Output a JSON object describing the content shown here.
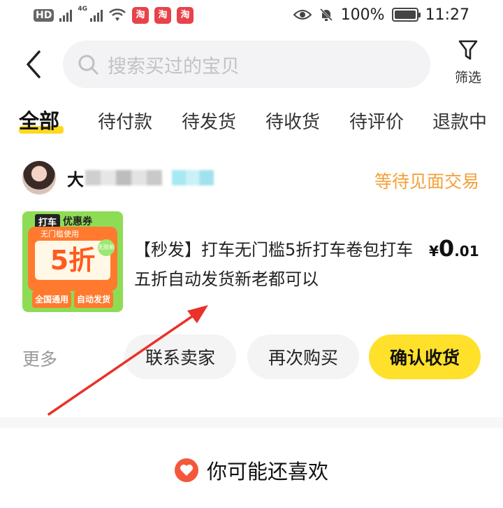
{
  "status_bar": {
    "hd": "HD",
    "network": "4G",
    "apps": [
      "淘",
      "淘",
      "淘"
    ],
    "battery": "100%",
    "time": "11:27"
  },
  "header": {
    "search_placeholder": "搜索买过的宝贝",
    "filter_label": "筛选"
  },
  "tabs": [
    {
      "label": "全部",
      "active": true
    },
    {
      "label": "待付款"
    },
    {
      "label": "待发货"
    },
    {
      "label": "待收货"
    },
    {
      "label": "待评价"
    },
    {
      "label": "退款中"
    }
  ],
  "order": {
    "seller_initial": "大",
    "status": "等待见面交易",
    "product_title": "【秒发】打车无门槛5折打车卷包打车五折自动发货新老都可以",
    "price": {
      "symbol": "¥",
      "integer": "0",
      "decimal": ".01"
    },
    "thumbnail": {
      "tag": "打车",
      "tag2": "优惠券",
      "subtitle": "无门槛使用",
      "main": "5折",
      "badge": "无限新老",
      "bottom_left": "全国通用",
      "bottom_right": "自动发货"
    },
    "actions": {
      "more": "更多",
      "contact_seller": "联系卖家",
      "buy_again": "再次购买",
      "confirm_receipt": "确认收货"
    }
  },
  "recommend": {
    "title": "你可能还喜欢"
  },
  "colors": {
    "accent_yellow": "#ffe02b",
    "status_orange": "#f3a13a",
    "heart_red": "#f5573b",
    "annotation_arrow": "#e8322a"
  }
}
